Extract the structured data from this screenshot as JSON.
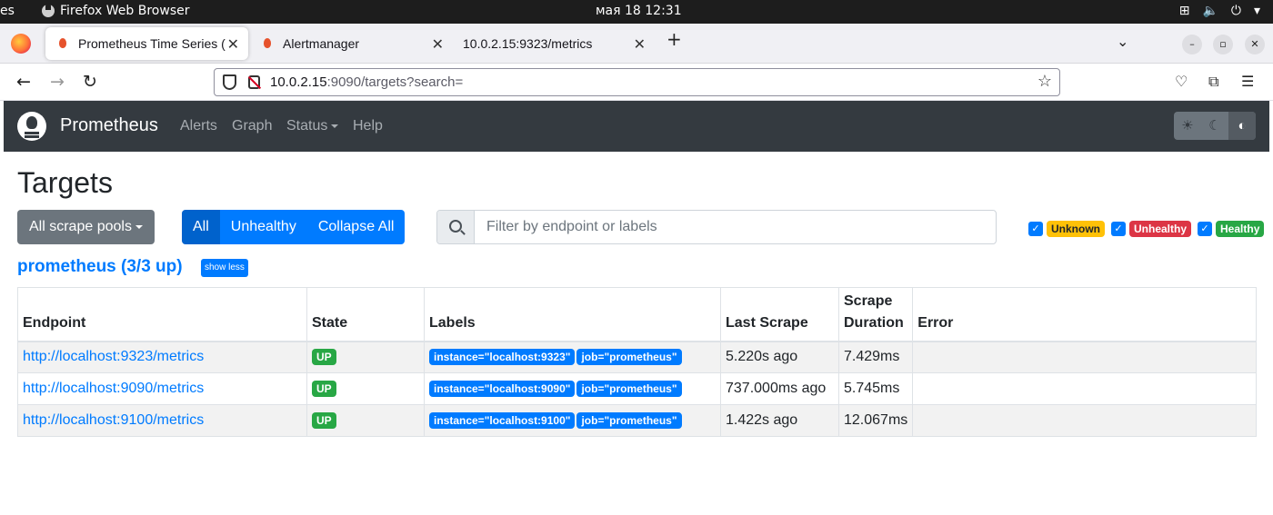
{
  "os": {
    "activities": "es",
    "app_name": "Firefox Web Browser",
    "clock": "мая 18  12:31"
  },
  "browser": {
    "tabs": [
      {
        "title": "Prometheus Time Series (",
        "active": true
      },
      {
        "title": "Alertmanager",
        "active": false
      },
      {
        "title": "10.0.2.15:9323/metrics",
        "active": false
      }
    ],
    "url_host": "10.0.2.15",
    "url_rest": ":9090/targets?search="
  },
  "prom": {
    "brand": "Prometheus",
    "nav": [
      "Alerts",
      "Graph",
      "Status",
      "Help"
    ]
  },
  "page": {
    "title": "Targets",
    "pools_button": "All scrape pools",
    "filters": [
      "All",
      "Unhealthy",
      "Collapse All"
    ],
    "search_placeholder": "Filter by endpoint or labels",
    "health": [
      "Unknown",
      "Unhealthy",
      "Healthy"
    ],
    "job_header": "prometheus (3/3 up)",
    "show_less": "show less"
  },
  "table": {
    "headers": [
      "Endpoint",
      "State",
      "Labels",
      "Last Scrape",
      "Scrape Duration",
      "Error"
    ],
    "rows": [
      {
        "endpoint": "http://localhost:9323/metrics",
        "state": "UP",
        "labels": [
          "instance=\"localhost:9323\"",
          "job=\"prometheus\""
        ],
        "last_scrape": "5.220s ago",
        "duration": "7.429ms",
        "error": ""
      },
      {
        "endpoint": "http://localhost:9090/metrics",
        "state": "UP",
        "labels": [
          "instance=\"localhost:9090\"",
          "job=\"prometheus\""
        ],
        "last_scrape": "737.000ms ago",
        "duration": "5.745ms",
        "error": ""
      },
      {
        "endpoint": "http://localhost:9100/metrics",
        "state": "UP",
        "labels": [
          "instance=\"localhost:9100\"",
          "job=\"prometheus\""
        ],
        "last_scrape": "1.422s ago",
        "duration": "12.067ms",
        "error": ""
      }
    ]
  },
  "colors": {
    "primary": "#007bff",
    "navbar": "#343a40",
    "success": "#28a745",
    "warning": "#ffc107",
    "danger": "#dc3545",
    "secondary": "#6c757d"
  }
}
